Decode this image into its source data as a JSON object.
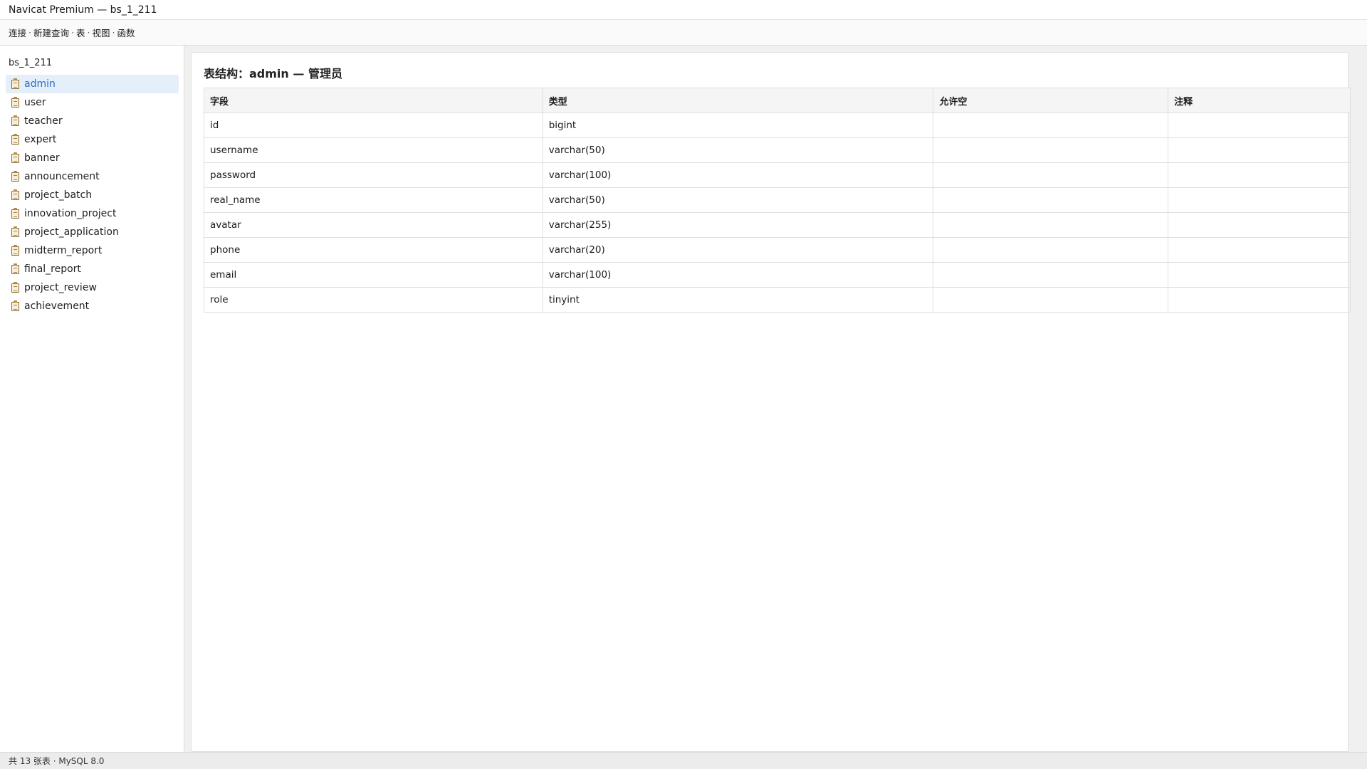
{
  "window": {
    "title": "Navicat Premium — bs_1_211"
  },
  "toolbar": {
    "items": [
      "连接",
      "新建查询",
      "表",
      "视图",
      "函数"
    ],
    "separator": "·"
  },
  "sidebar": {
    "db_name": "bs_1_211",
    "tables": [
      "admin",
      "user",
      "teacher",
      "expert",
      "banner",
      "announcement",
      "project_batch",
      "innovation_project",
      "project_application",
      "midterm_report",
      "final_report",
      "project_review",
      "achievement"
    ],
    "selected": "admin",
    "icon": "table-icon"
  },
  "main": {
    "title": "表结构：admin — 管理员",
    "columns": [
      "字段",
      "类型",
      "允许空",
      "注释"
    ],
    "rows": [
      [
        "id",
        "bigint",
        "",
        ""
      ],
      [
        "username",
        "varchar(50)",
        "",
        ""
      ],
      [
        "password",
        "varchar(100)",
        "",
        ""
      ],
      [
        "real_name",
        "varchar(50)",
        "",
        ""
      ],
      [
        "avatar",
        "varchar(255)",
        "",
        ""
      ],
      [
        "phone",
        "varchar(20)",
        "",
        ""
      ],
      [
        "email",
        "varchar(100)",
        "",
        ""
      ],
      [
        "role",
        "tinyint",
        "",
        ""
      ]
    ]
  },
  "status": {
    "text": "共 13 张表 · MySQL 8.0"
  },
  "colors": {
    "selected_bg": "#e4effb",
    "selected_text": "#2a6fc0",
    "header_bg": "#f5f5f5",
    "status_bg": "#ececec"
  }
}
